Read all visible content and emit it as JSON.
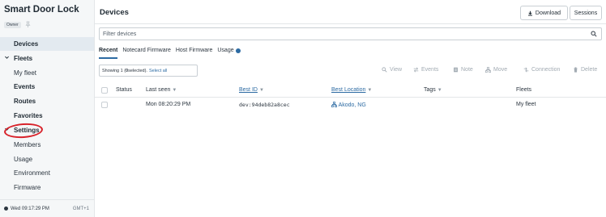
{
  "sidebar": {
    "app_title": "Smart Door Lock",
    "role_badge": "Owner",
    "items": [
      {
        "label": "Devices"
      },
      {
        "label": "Fleets"
      },
      {
        "label": "My fleet"
      },
      {
        "label": "Events"
      },
      {
        "label": "Routes"
      },
      {
        "label": "Favorites"
      },
      {
        "label": "Settings"
      },
      {
        "label": "Members"
      },
      {
        "label": "Usage"
      },
      {
        "label": "Environment"
      },
      {
        "label": "Firmware"
      }
    ],
    "footer_time": "Wed 09:17:29 PM",
    "footer_tz": "GMT+1"
  },
  "header": {
    "title": "Devices",
    "download_label": "Download",
    "sessions_label": "Sessions"
  },
  "filter": {
    "placeholder": "Filter devices"
  },
  "tabs": [
    {
      "label": "Recent"
    },
    {
      "label": "Notecard Firmware"
    },
    {
      "label": "Host Firmware"
    },
    {
      "label": "Usage"
    }
  ],
  "selection": {
    "showing_prefix": "Showing 1 (",
    "selected_count": "0",
    "showing_suffix": " selected).",
    "select_all": "Select all"
  },
  "toolbar": {
    "view": "View",
    "events": "Events",
    "note": "Note",
    "move": "Move",
    "connection": "Connection",
    "delete": "Delete"
  },
  "table": {
    "columns": [
      "Status",
      "Last seen",
      "Best ID",
      "Best Location",
      "Tags",
      "Fleets"
    ],
    "rows": [
      {
        "status": "",
        "last_seen": "Mon 08:20:29 PM",
        "best_id": "dev:94deb82a8cec",
        "best_location": "Akodo, NG",
        "tags": "",
        "fleets": "My fleet"
      }
    ]
  },
  "colors": {
    "accent": "#2d6ba3",
    "annotation": "#d8222a"
  }
}
